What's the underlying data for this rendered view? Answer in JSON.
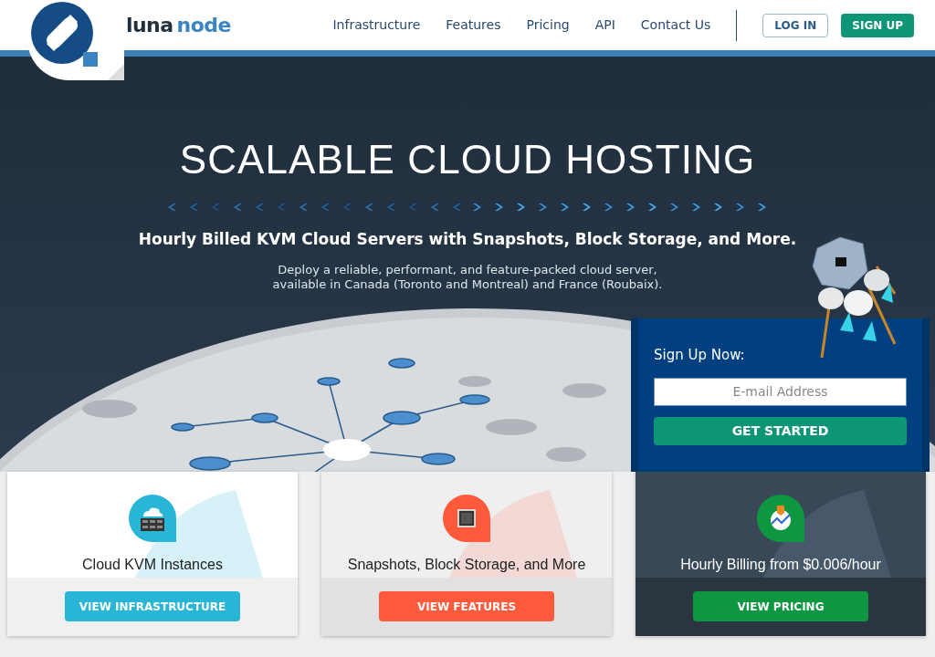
{
  "logo": {
    "word_1": "luna",
    "word_2": "node"
  },
  "nav": {
    "items": [
      "Infrastructure",
      "Features",
      "Pricing",
      "API",
      "Contact Us"
    ],
    "login": "LOG IN",
    "signup": "SIGN UP"
  },
  "hero": {
    "title": "SCALABLE CLOUD HOSTING",
    "subtitle": "Hourly Billed KVM Cloud Servers with Snapshots, Block Storage, and More.",
    "description_lines": [
      "Deploy a reliable, performant, and feature-packed cloud server,",
      "available in Canada (Toronto and Montreal) and France (Roubaix)."
    ]
  },
  "signup_panel": {
    "label": "Sign Up Now:",
    "email_placeholder": "E-mail Address",
    "button": "GET STARTED"
  },
  "cards": [
    {
      "kind": "light",
      "color": "#29b6d6",
      "title": "Cloud KVM Instances",
      "button": "VIEW INFRASTRUCTURE"
    },
    {
      "kind": "grey",
      "color": "#ff5a3c",
      "title": "Snapshots, Block Storage, and More",
      "button": "VIEW FEATURES"
    },
    {
      "kind": "dark",
      "color": "#0e9640",
      "title": "Hourly Billing from $0.006/hour",
      "button": "VIEW PRICING"
    }
  ]
}
